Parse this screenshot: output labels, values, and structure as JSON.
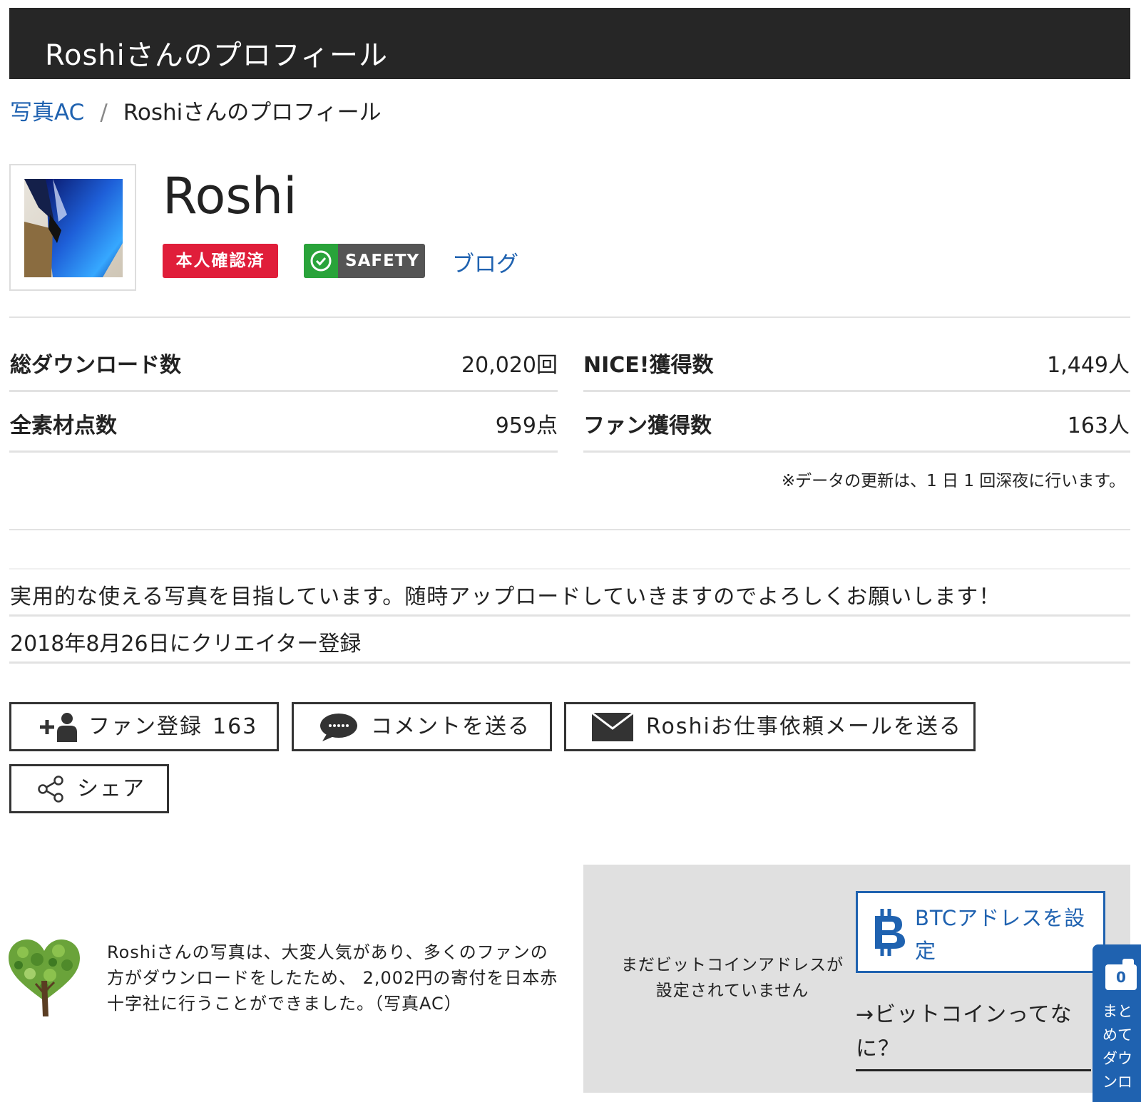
{
  "header": {
    "title": "Roshiさんのプロフィール"
  },
  "breadcrumb": {
    "home": "写真AC",
    "separator": "/",
    "current": "Roshiさんのプロフィール"
  },
  "profile": {
    "name": "Roshi",
    "badge_verified": "本人確認済",
    "badge_safety": "SAFETY",
    "blog_link": "ブログ"
  },
  "stats": {
    "downloads_label": "総ダウンロード数",
    "downloads_value": "20,020回",
    "nice_label": "NICE!獲得数",
    "nice_value": "1,449人",
    "materials_label": "全素材点数",
    "materials_value": "959点",
    "fans_label": "ファン獲得数",
    "fans_value": "163人",
    "update_note": "※データの更新は、1 日 1 回深夜に行います。"
  },
  "bio": "実用的な使える写真を目指しています。随時アップロードしていきますのでよろしくお願いします！",
  "registered": "2018年8月26日にクリエイター登録",
  "actions": {
    "fan_label": "ファン登録",
    "fan_count": "163",
    "comment_label": "コメントを送る",
    "mail_label": "Roshiお仕事依頼メールを送る",
    "share_label": "シェア"
  },
  "charity": {
    "text": "Roshiさんの写真は、大変人気があり、多くのファンの方がダウンロードをしたため、 2,002円の寄付を日本赤十字社に行うことができました。（写真AC）"
  },
  "btc": {
    "message": "まだビットコインアドレスが設定されていません",
    "button_label": "BTCアドレスを設定",
    "what_link": "→ビットコインってなに？"
  },
  "floating": {
    "count": "0",
    "label": "まとめてダウンロ"
  },
  "colors": {
    "header_bg": "#262626",
    "link": "#1f62b0",
    "verified_red": "#e01e3a",
    "safety_green": "#29a33a",
    "btc_panel": "#e0e0e0"
  }
}
